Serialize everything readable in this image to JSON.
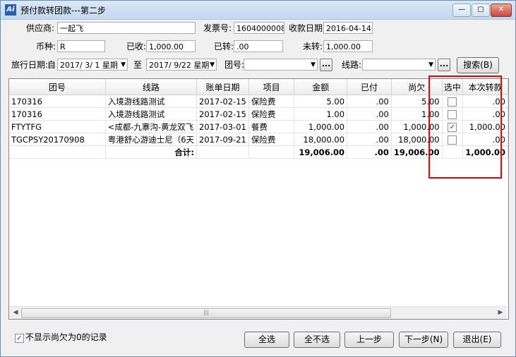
{
  "window": {
    "title": "预付款转团款---第二步",
    "min_symbol": "—",
    "max_symbol": "▢",
    "close_symbol": "✕",
    "app_icon": "Ai"
  },
  "form": {
    "supplier_label": "供应商:",
    "supplier_value": "一起飞",
    "invoice_label": "发票号:",
    "invoice_value": "1604000008",
    "receipt_date_label": "收款日期:",
    "receipt_date_value": "2016-04-14",
    "currency_label": "币种:",
    "currency_value": "R",
    "received_label": "已收:",
    "received_value": "1,000.00",
    "transferred_label": "已转:",
    "transferred_value": ".00",
    "untransferred_label": "未转:",
    "untransferred_value": "1,000.00",
    "travel_date_label": "旅行日期:",
    "from_label": "自",
    "date_from": "2017/ 3/ 1 星期",
    "to_label": "至",
    "date_to": "2017/ 9/22 星期",
    "group_label": "团号:",
    "route_label": "线路:",
    "ellipsis": "...",
    "search_button": "搜索(B)"
  },
  "table": {
    "columns": [
      "团号",
      "线路",
      "账单日期",
      "项目",
      "金额",
      "已付",
      "尚欠",
      "选中",
      "本次转款"
    ],
    "rows": [
      {
        "group": "170316",
        "route": "入境游线路测试",
        "date": "2017-02-15",
        "item": "保险费",
        "amount": "5.00",
        "paid": ".00",
        "owed": "5.00",
        "checked": false,
        "transfer": ".00"
      },
      {
        "group": "170316",
        "route": "入境游线路测试",
        "date": "2017-02-15",
        "item": "保险费",
        "amount": "1.00",
        "paid": ".00",
        "owed": "1.00",
        "checked": false,
        "transfer": ".00"
      },
      {
        "group": "FTYTFG",
        "route": "<成都-九寨沟-黄龙双飞",
        "date": "2017-03-01",
        "item": "餐费",
        "amount": "1,000.00",
        "paid": ".00",
        "owed": "1,000.00",
        "checked": true,
        "transfer": "1,000.00"
      },
      {
        "group": "TGCPSY20170908",
        "route": "粤港舒心游迪士尼（6天",
        "date": "2017-09-21",
        "item": "保险费",
        "amount": "18,000.00",
        "paid": ".00",
        "owed": "18,000.00",
        "checked": false,
        "transfer": ".00"
      }
    ],
    "total": {
      "label": "合计:",
      "amount": "19,006.00",
      "paid": ".00",
      "owed": "19,006.00",
      "transfer": "1,000.00"
    },
    "scroll_left": "◀",
    "scroll_right": "▶",
    "scroll_grip": "|||"
  },
  "footer": {
    "hide_zero_label": "不显示尚欠为0的记录",
    "hide_zero_checked": true,
    "select_all": "全选",
    "select_none": "全不选",
    "prev": "上一步",
    "next": "下一步(N)",
    "exit": "退出(E)"
  }
}
